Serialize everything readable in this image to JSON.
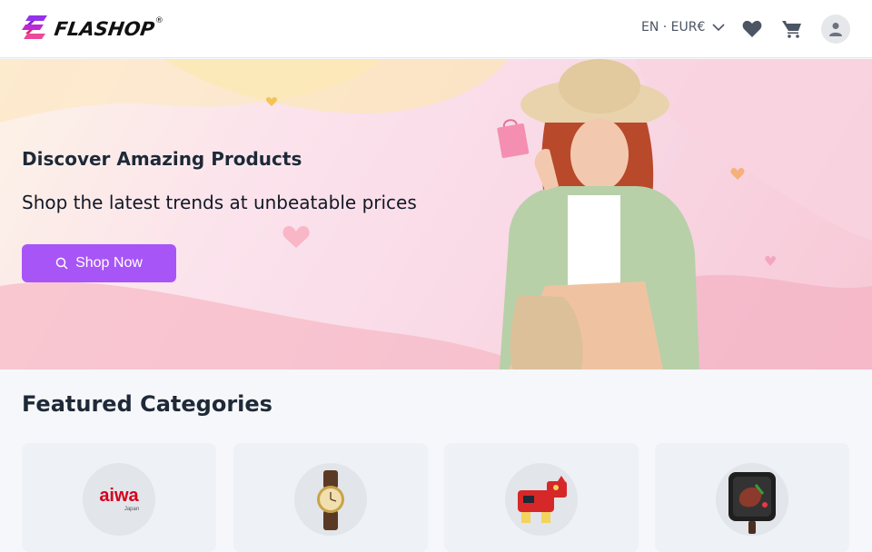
{
  "header": {
    "brand": "FLASHOP",
    "brand_mark": "®",
    "locale": "EN · EUR€",
    "icons": {
      "wishlist": "heart-icon",
      "cart": "cart-icon",
      "account": "user-icon"
    }
  },
  "hero": {
    "title": "Discover Amazing Products",
    "subtitle": "Shop the latest trends at unbeatable prices",
    "cta_label": "Shop Now",
    "cta_icon": "search-icon",
    "image": "woman-in-straw-hat-with-shopping-bags"
  },
  "featured": {
    "title": "Featured Categories",
    "cards": [
      {
        "icon": "aiwa-logo",
        "logo_text": "aiwa",
        "logo_sub": "Japan"
      },
      {
        "icon": "wristwatch-icon"
      },
      {
        "icon": "toy-robot-icon"
      },
      {
        "icon": "grill-pan-icon"
      }
    ]
  },
  "colors": {
    "accent": "#a855f7",
    "logo_purple": "#9333ea",
    "logo_pink": "#ec4899",
    "aiwa_red": "#d6001c"
  }
}
